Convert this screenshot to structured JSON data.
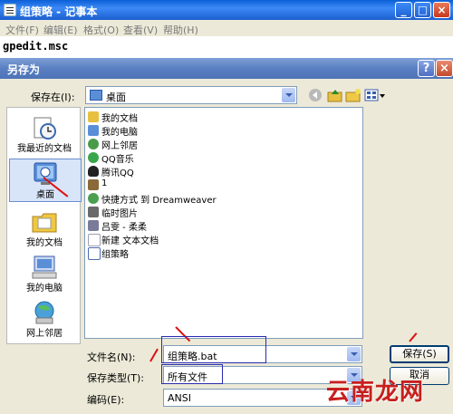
{
  "notepad": {
    "title": "组策略 - 记事本",
    "menu": [
      "文件(F)",
      "编辑(E)",
      "格式(O)",
      "查看(V)",
      "帮助(H)"
    ],
    "content": "gpedit.msc",
    "buttons": {
      "minimize": "_",
      "maximize": "□",
      "close": "×"
    }
  },
  "dialog": {
    "title": "另存为",
    "help_button": "?",
    "close_button": "×",
    "save_in_label": "保存在(I):",
    "save_in_value": "桌面",
    "places": [
      {
        "label": "我最近的文档",
        "icon": "recent-documents-icon"
      },
      {
        "label": "桌面",
        "icon": "desktop-icon"
      },
      {
        "label": "我的文档",
        "icon": "my-documents-icon"
      },
      {
        "label": "我的电脑",
        "icon": "my-computer-icon"
      },
      {
        "label": "网上邻居",
        "icon": "network-places-icon"
      }
    ],
    "files": [
      {
        "name": "我的文档",
        "icon": "my-documents-icon",
        "color": "#e8c040"
      },
      {
        "name": "我的电脑",
        "icon": "my-computer-icon",
        "color": "#5a8fd8"
      },
      {
        "name": "网上邻居",
        "icon": "network-places-icon",
        "color": "#4a9a4a"
      },
      {
        "name": "QQ音乐",
        "icon": "qq-music-icon",
        "color": "#3aa64a"
      },
      {
        "name": "腾讯QQ",
        "icon": "qq-penguin-icon",
        "color": "#222222"
      },
      {
        "name": "1",
        "icon": "file-icon",
        "color": "#8a6a3a"
      },
      {
        "name": "快捷方式 到 Dreamweaver",
        "icon": "shortcut-icon",
        "color": "#4aa050"
      },
      {
        "name": "临时图片",
        "icon": "image-folder-icon",
        "color": "#6a6a6a"
      },
      {
        "name": "吕雯 - 柔柔",
        "icon": "music-file-icon",
        "color": "#7a7a9a"
      },
      {
        "name": "新建 文本文档",
        "icon": "text-file-icon",
        "color": "#9aa0b0"
      },
      {
        "name": "组策略",
        "icon": "text-file-icon",
        "color": "#4a6ab0"
      }
    ],
    "filename_label": "文件名(N):",
    "filename_value": "组策略.bat",
    "filetype_label": "保存类型(T):",
    "filetype_value": "所有文件",
    "encoding_label": "编码(E):",
    "encoding_value": "ANSI",
    "save_button": "保存(S)",
    "cancel_button": "取消"
  },
  "watermark": "云南龙网"
}
